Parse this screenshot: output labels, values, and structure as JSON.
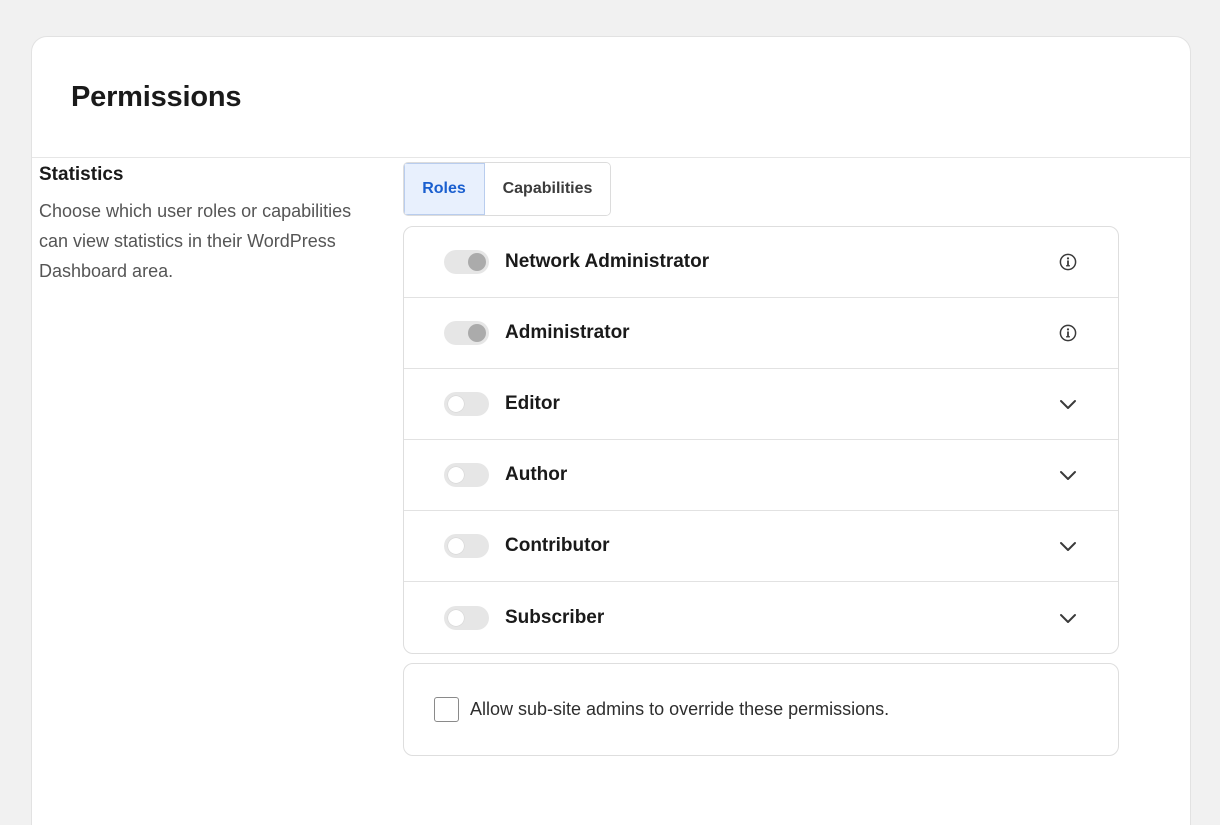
{
  "page": {
    "title": "Permissions"
  },
  "section": {
    "title": "Statistics",
    "description": "Choose which user roles or capabilities can view statistics in their WordPress Dashboard area."
  },
  "tabs": [
    {
      "label": "Roles",
      "active": true
    },
    {
      "label": "Capabilities",
      "active": false
    }
  ],
  "roles": [
    {
      "label": "Network Administrator",
      "state": "locked-on",
      "icon": "info-icon"
    },
    {
      "label": "Administrator",
      "state": "locked-on",
      "icon": "info-icon"
    },
    {
      "label": "Editor",
      "state": "off",
      "icon": "chevron-down-icon"
    },
    {
      "label": "Author",
      "state": "off",
      "icon": "chevron-down-icon"
    },
    {
      "label": "Contributor",
      "state": "off",
      "icon": "chevron-down-icon"
    },
    {
      "label": "Subscriber",
      "state": "off",
      "icon": "chevron-down-icon"
    }
  ],
  "override": {
    "label": "Allow sub-site admins to override these permissions.",
    "checked": false
  },
  "colors": {
    "accent": "#1a5fcf",
    "active_tab_bg": "#e8f0fd",
    "background": "#f1f1f1"
  }
}
